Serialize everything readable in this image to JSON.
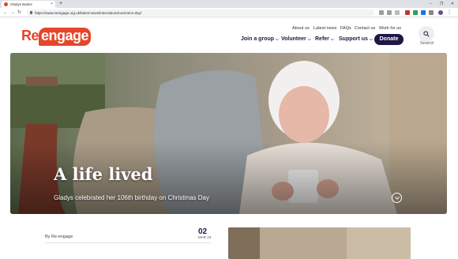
{
  "browser": {
    "tab_title": "Gladys Banks",
    "tab_close": "×",
    "new_tab": "+",
    "url": "https://www.reengage.org.uk/latest-news/international-womens-day/",
    "window_controls": [
      "–",
      "❐",
      "✕"
    ]
  },
  "site": {
    "logo_prefix": "Re",
    "logo_bubble": "engage",
    "utility_nav": [
      "About us",
      "Latest news",
      "FAQs",
      "Contact us",
      "Work for us"
    ],
    "main_nav": [
      "Join a group",
      "Volunteer",
      "Refer",
      "Support us"
    ],
    "donate_label": "Donate",
    "search_label": "Search",
    "colors": {
      "brand_orange": "#e5462b",
      "navy": "#1d1847"
    }
  },
  "hero": {
    "title": "A life lived",
    "subtitle": "Gladys celebrated her 106th birthday on Christmas Day"
  },
  "article": {
    "byline": "By Re-engage",
    "date_day": "02",
    "date_month": "MAR 23"
  }
}
